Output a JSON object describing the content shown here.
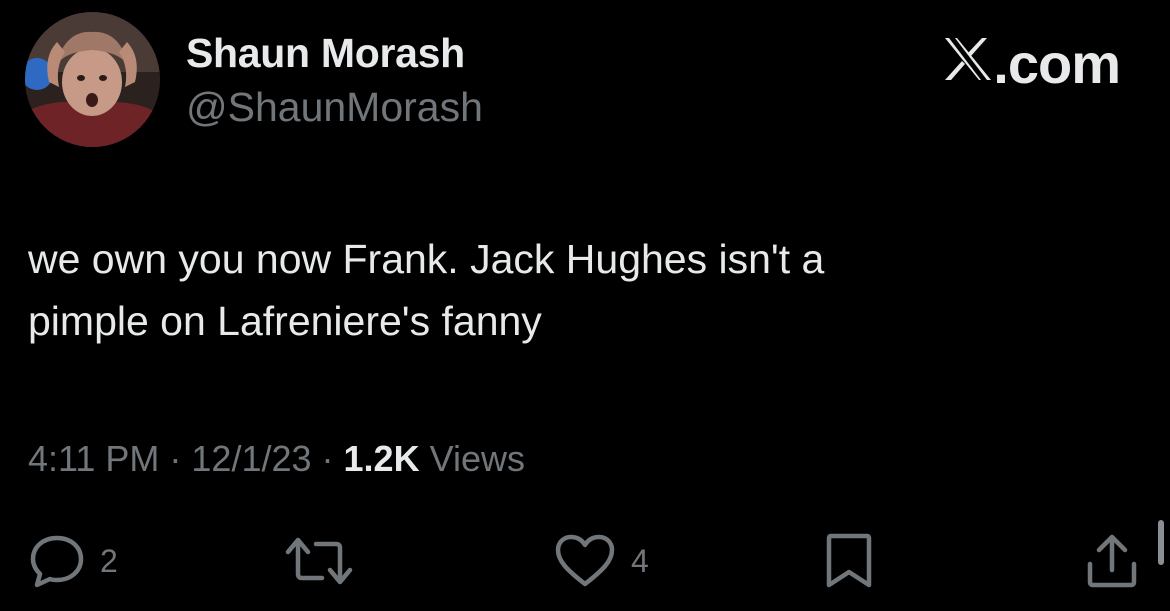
{
  "author": {
    "display_name": "Shaun Morash",
    "handle": "@ShaunMorash"
  },
  "brand": {
    "label": ".com",
    "icon": "x-logo-icon"
  },
  "tweet": {
    "text_line_1": "we own you now Frank. Jack Hughes isn't a",
    "text_line_2": "pimple on Lafreniere's fanny"
  },
  "meta": {
    "time": "4:11 PM",
    "date": "12/1/23",
    "views_count": "1.2K",
    "views_label": "Views",
    "separator": "·"
  },
  "actions": {
    "reply": {
      "icon": "reply-icon",
      "count": "2"
    },
    "retweet": {
      "icon": "retweet-icon"
    },
    "like": {
      "icon": "heart-icon",
      "count": "4"
    },
    "bookmark": {
      "icon": "bookmark-icon"
    },
    "share": {
      "icon": "share-icon"
    }
  },
  "colors": {
    "background": "#000000",
    "primary_text": "#e7e9ea",
    "secondary_text": "#71767b"
  }
}
